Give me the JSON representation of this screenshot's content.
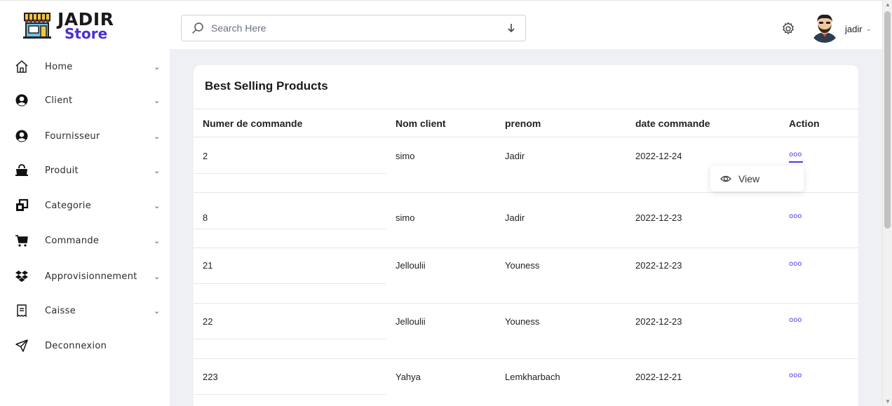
{
  "brand": {
    "name_top": "JADIR",
    "name_bottom": "Store"
  },
  "search": {
    "placeholder": "Search Here"
  },
  "user": {
    "name": "jadir"
  },
  "sidebar": {
    "items": [
      {
        "label": "Home",
        "icon": "home-icon",
        "has_chevron": true
      },
      {
        "label": "Client",
        "icon": "user-circle-icon",
        "has_chevron": true
      },
      {
        "label": "Fournisseur",
        "icon": "user-circle-icon",
        "has_chevron": true
      },
      {
        "label": "Produit",
        "icon": "shopping-bag-icon",
        "has_chevron": true
      },
      {
        "label": "Categorie",
        "icon": "layers-icon",
        "has_chevron": true
      },
      {
        "label": "Commande",
        "icon": "cart-icon",
        "has_chevron": true
      },
      {
        "label": "Approvisionnement",
        "icon": "dropbox-icon",
        "has_chevron": true
      },
      {
        "label": "Caisse",
        "icon": "receipt-icon",
        "has_chevron": true
      },
      {
        "label": "Deconnexion",
        "icon": "send-icon",
        "has_chevron": false
      }
    ]
  },
  "main": {
    "title": "Best Selling Products",
    "table": {
      "headers": [
        "Numer de commande",
        "Nom client",
        "prenom",
        "date commande",
        "Action"
      ],
      "rows": [
        {
          "numero": "2",
          "nom": "simo",
          "prenom": "Jadir",
          "date": "2022-12-24",
          "action": "ooo"
        },
        {
          "numero": "8",
          "nom": "simo",
          "prenom": "Jadir",
          "date": "2022-12-23",
          "action": "ooo"
        },
        {
          "numero": "21",
          "nom": "Jelloulii",
          "prenom": "Youness",
          "date": "2022-12-23",
          "action": "ooo"
        },
        {
          "numero": "22",
          "nom": "Jelloulii",
          "prenom": "Youness",
          "date": "2022-12-23",
          "action": "ooo"
        },
        {
          "numero": "223",
          "nom": "Yahya",
          "prenom": "Lemkharbach",
          "date": "2022-12-21",
          "action": "ooo"
        }
      ]
    },
    "action_menu": {
      "view_label": "View"
    }
  },
  "colors": {
    "accent": "#4a3bdc",
    "background": "#eef0f3"
  }
}
